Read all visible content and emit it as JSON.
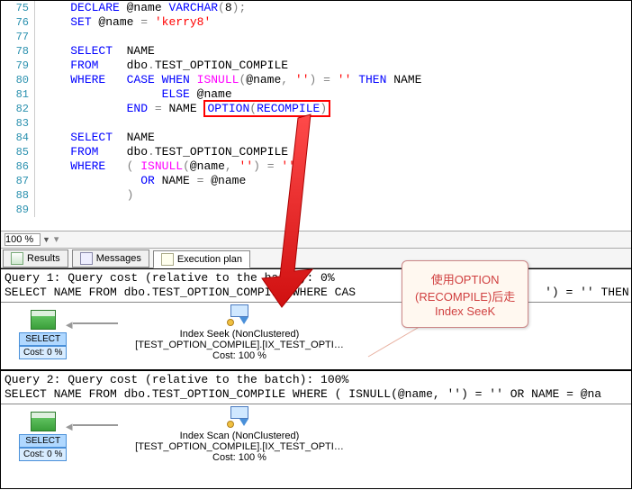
{
  "editor": {
    "lines": [
      {
        "n": 75,
        "tokens": [
          {
            "t": "    ",
            "c": ""
          },
          {
            "t": "DECLARE",
            "c": "kw"
          },
          {
            "t": " @name ",
            "c": ""
          },
          {
            "t": "VARCHAR",
            "c": "kw"
          },
          {
            "t": "(",
            "c": "op"
          },
          {
            "t": "8",
            "c": ""
          },
          {
            "t": ");",
            "c": "op"
          }
        ]
      },
      {
        "n": 76,
        "tokens": [
          {
            "t": "    ",
            "c": ""
          },
          {
            "t": "SET",
            "c": "kw"
          },
          {
            "t": " @name ",
            "c": ""
          },
          {
            "t": "=",
            "c": "op"
          },
          {
            "t": " ",
            "c": ""
          },
          {
            "t": "'kerry8'",
            "c": "str"
          }
        ]
      },
      {
        "n": 77,
        "tokens": []
      },
      {
        "n": 78,
        "tokens": [
          {
            "t": "    ",
            "c": ""
          },
          {
            "t": "SELECT",
            "c": "kw"
          },
          {
            "t": "  NAME",
            "c": ""
          }
        ]
      },
      {
        "n": 79,
        "tokens": [
          {
            "t": "    ",
            "c": ""
          },
          {
            "t": "FROM",
            "c": "kw"
          },
          {
            "t": "    dbo",
            "c": ""
          },
          {
            "t": ".",
            "c": "op"
          },
          {
            "t": "TEST_OPTION_COMPILE",
            "c": ""
          }
        ]
      },
      {
        "n": 80,
        "tokens": [
          {
            "t": "    ",
            "c": ""
          },
          {
            "t": "WHERE",
            "c": "kw"
          },
          {
            "t": "   ",
            "c": ""
          },
          {
            "t": "CASE WHEN ",
            "c": "kw"
          },
          {
            "t": "ISNULL",
            "c": "func"
          },
          {
            "t": "(",
            "c": "op"
          },
          {
            "t": "@name",
            "c": ""
          },
          {
            "t": ",",
            "c": "op"
          },
          {
            "t": " ",
            "c": ""
          },
          {
            "t": "''",
            "c": "str"
          },
          {
            "t": ")",
            "c": "op"
          },
          {
            "t": " ",
            "c": ""
          },
          {
            "t": "=",
            "c": "op"
          },
          {
            "t": " ",
            "c": ""
          },
          {
            "t": "''",
            "c": "str"
          },
          {
            "t": " ",
            "c": ""
          },
          {
            "t": "THEN",
            "c": "kw"
          },
          {
            "t": " NAME",
            "c": ""
          }
        ]
      },
      {
        "n": 81,
        "tokens": [
          {
            "t": "                 ",
            "c": ""
          },
          {
            "t": "ELSE",
            "c": "kw"
          },
          {
            "t": " @name",
            "c": ""
          }
        ]
      },
      {
        "n": 82,
        "tokens": [
          {
            "t": "            ",
            "c": ""
          },
          {
            "t": "END",
            "c": "kw"
          },
          {
            "t": " ",
            "c": ""
          },
          {
            "t": "=",
            "c": "op"
          },
          {
            "t": " NAME ",
            "c": ""
          },
          {
            "t": "OPTION",
            "c": "kw",
            "box": true
          },
          {
            "t": "(",
            "c": "op",
            "box": true
          },
          {
            "t": "RECOMPILE",
            "c": "kw",
            "box": true
          },
          {
            "t": ")",
            "c": "op",
            "box": true
          }
        ]
      },
      {
        "n": 83,
        "tokens": []
      },
      {
        "n": 84,
        "tokens": [
          {
            "t": "    ",
            "c": ""
          },
          {
            "t": "SELECT",
            "c": "kw"
          },
          {
            "t": "  NAME",
            "c": ""
          }
        ]
      },
      {
        "n": 85,
        "tokens": [
          {
            "t": "    ",
            "c": ""
          },
          {
            "t": "FROM",
            "c": "kw"
          },
          {
            "t": "    dbo",
            "c": ""
          },
          {
            "t": ".",
            "c": "op"
          },
          {
            "t": "TEST_OPTION_COMPILE",
            "c": ""
          }
        ]
      },
      {
        "n": 86,
        "tokens": [
          {
            "t": "    ",
            "c": ""
          },
          {
            "t": "WHERE",
            "c": "kw"
          },
          {
            "t": "   ",
            "c": ""
          },
          {
            "t": "( ",
            "c": "op"
          },
          {
            "t": "ISNULL",
            "c": "func"
          },
          {
            "t": "(",
            "c": "op"
          },
          {
            "t": "@name",
            "c": ""
          },
          {
            "t": ",",
            "c": "op"
          },
          {
            "t": " ",
            "c": ""
          },
          {
            "t": "''",
            "c": "str"
          },
          {
            "t": ")",
            "c": "op"
          },
          {
            "t": " ",
            "c": ""
          },
          {
            "t": "=",
            "c": "op"
          },
          {
            "t": " ",
            "c": ""
          },
          {
            "t": "''",
            "c": "str"
          }
        ]
      },
      {
        "n": 87,
        "tokens": [
          {
            "t": "              ",
            "c": ""
          },
          {
            "t": "OR",
            "c": "kw"
          },
          {
            "t": " NAME ",
            "c": ""
          },
          {
            "t": "=",
            "c": "op"
          },
          {
            "t": " @name",
            "c": ""
          }
        ]
      },
      {
        "n": 88,
        "tokens": [
          {
            "t": "            ",
            "c": ""
          },
          {
            "t": ")",
            "c": "op"
          }
        ]
      },
      {
        "n": 89,
        "tokens": []
      }
    ]
  },
  "zoom": "100 %",
  "tabs": {
    "results": "Results",
    "messages": "Messages",
    "plan": "Execution plan"
  },
  "query1": {
    "header": "Query 1: Query cost (relative to the batch): 0%\nSELECT NAME FROM dbo.TEST_OPTION_COMPILE WHERE CAS",
    "header_tail": "') = '' THEN ",
    "select_label": "SELECT",
    "select_cost": "Cost: 0 %",
    "op_title": "Index Seek (NonClustered)",
    "op_detail": "[TEST_OPTION_COMPILE].[IX_TEST_OPTI…",
    "op_cost": "Cost: 100 %"
  },
  "query2": {
    "header": "Query 2: Query cost (relative to the batch): 100%\nSELECT NAME FROM dbo.TEST_OPTION_COMPILE WHERE ( ISNULL(@name, '') = '' OR NAME = @na",
    "select_label": "SELECT",
    "select_cost": "Cost: 0 %",
    "op_title": "Index Scan (NonClustered)",
    "op_detail": "[TEST_OPTION_COMPILE].[IX_TEST_OPTI…",
    "op_cost": "Cost: 100 %"
  },
  "callout": {
    "line1": "使用OPTION",
    "line2": "(RECOMPILE)后走",
    "line3": "Index SeeK"
  }
}
